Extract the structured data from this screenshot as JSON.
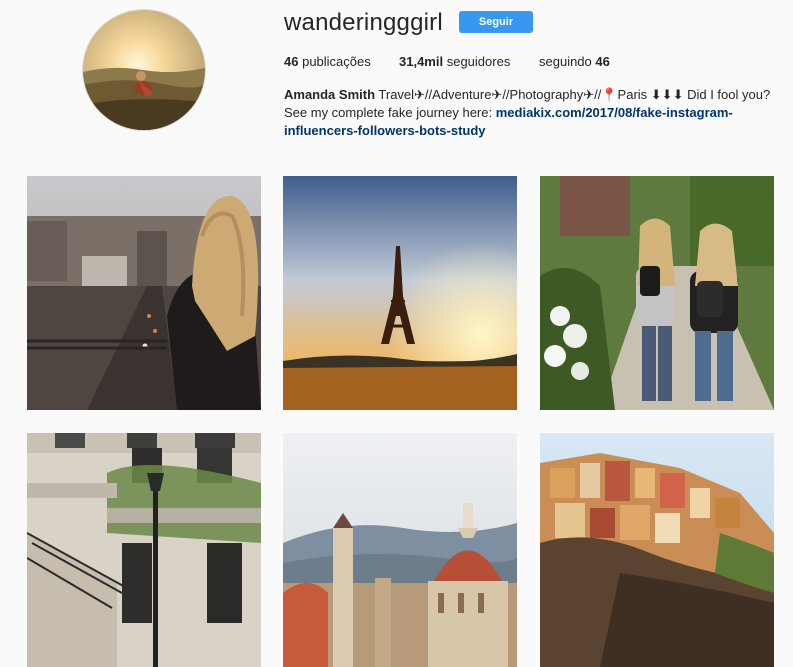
{
  "profile": {
    "username": "wanderingggirl",
    "follow_label": "Seguir",
    "stats": {
      "posts_count": "46",
      "posts_label": "publicações",
      "followers_count": "31,4mil",
      "followers_label": "seguidores",
      "following_label": "seguindo",
      "following_count": "46"
    },
    "bio": {
      "name": "Amanda Smith",
      "text": "Travel✈//Adventure✈//Photography✈//📍Paris ⬇⬇⬇ Did I fool you? See my complete fake journey here:",
      "link": "mediakix.com/2017/08/fake-instagram-influencers-followers-bots-study"
    }
  },
  "posts": [
    {
      "name": "post-city-balcony"
    },
    {
      "name": "post-eiffel-tower-sunset"
    },
    {
      "name": "post-two-girls-walking"
    },
    {
      "name": "post-paris-building"
    },
    {
      "name": "post-florence-duomo"
    },
    {
      "name": "post-cinque-terre"
    }
  ],
  "colors": {
    "accent": "#3897f0",
    "link": "#003569",
    "background": "#fafafa"
  }
}
